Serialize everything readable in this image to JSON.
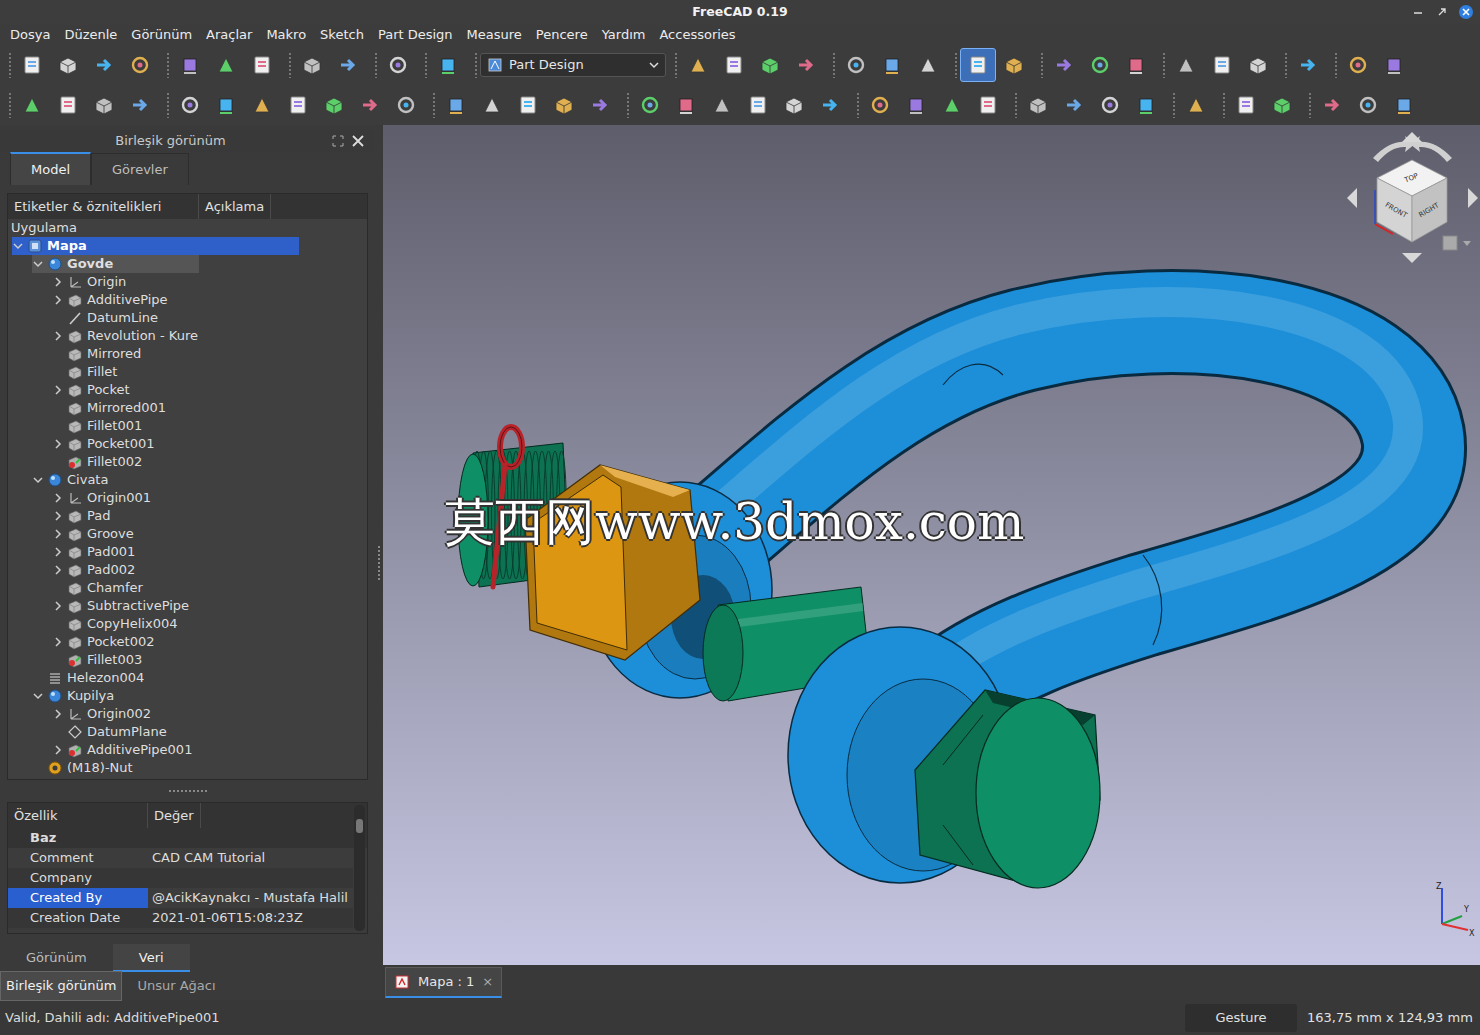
{
  "window": {
    "title": "FreeCAD 0.19"
  },
  "menu": [
    "Dosya",
    "Düzenle",
    "Görünüm",
    "Araçlar",
    "Makro",
    "Sketch",
    "Part Design",
    "Measure",
    "Pencere",
    "Yardım",
    "Accessories"
  ],
  "toolbar": {
    "rows": [
      [
        {
          "kind": "buttons",
          "buttons": [
            {
              "selected": false
            },
            {
              "selected": false
            },
            {
              "selected": false
            },
            {
              "selected": false
            }
          ]
        },
        {
          "kind": "buttons",
          "buttons": [
            {
              "selected": false
            },
            {
              "selected": false
            },
            {
              "selected": false
            }
          ]
        },
        {
          "kind": "buttons",
          "buttons": [
            {
              "selected": false
            },
            {
              "selected": false
            }
          ]
        },
        {
          "kind": "buttons",
          "buttons": [
            {
              "selected": false
            }
          ]
        },
        {
          "kind": "buttons",
          "buttons": [
            {
              "selected": false
            }
          ]
        },
        {
          "kind": "workbench",
          "label": "Part Design"
        },
        {
          "kind": "buttons",
          "buttons": [
            {
              "selected": false
            },
            {
              "selected": false
            },
            {
              "selected": false
            },
            {
              "selected": false
            }
          ]
        },
        {
          "kind": "buttons",
          "buttons": [
            {
              "selected": false
            },
            {
              "selected": false
            },
            {
              "selected": false
            }
          ]
        },
        {
          "kind": "buttons",
          "buttons": [
            {
              "selected": true
            },
            {
              "selected": false
            }
          ]
        },
        {
          "kind": "buttons",
          "buttons": [
            {
              "selected": false
            },
            {
              "selected": false
            },
            {
              "selected": false
            }
          ]
        },
        {
          "kind": "buttons",
          "buttons": [
            {
              "selected": false
            },
            {
              "selected": false
            },
            {
              "selected": false
            }
          ]
        },
        {
          "kind": "buttons",
          "buttons": [
            {
              "selected": false
            }
          ]
        },
        {
          "kind": "buttons",
          "buttons": [
            {
              "selected": false
            },
            {
              "selected": false
            }
          ]
        }
      ],
      [
        {
          "kind": "buttons",
          "buttons": [
            {
              "selected": false
            },
            {
              "selected": false
            },
            {
              "selected": false
            },
            {
              "selected": false
            }
          ]
        },
        {
          "kind": "buttons",
          "buttons": [
            {
              "selected": false
            },
            {
              "selected": false
            },
            {
              "selected": false
            },
            {
              "selected": false
            },
            {
              "selected": false
            },
            {
              "selected": false
            },
            {
              "selected": false
            }
          ]
        },
        {
          "kind": "buttons",
          "buttons": [
            {
              "selected": false
            },
            {
              "selected": false
            },
            {
              "selected": false
            },
            {
              "selected": false
            },
            {
              "selected": false
            }
          ]
        },
        {
          "kind": "buttons",
          "buttons": [
            {
              "selected": false
            },
            {
              "selected": false
            },
            {
              "selected": false
            },
            {
              "selected": false
            },
            {
              "selected": false
            },
            {
              "selected": false
            }
          ]
        },
        {
          "kind": "buttons",
          "buttons": [
            {
              "selected": false
            },
            {
              "selected": false
            },
            {
              "selected": false
            },
            {
              "selected": false
            }
          ]
        },
        {
          "kind": "buttons",
          "buttons": [
            {
              "selected": false
            },
            {
              "selected": false
            },
            {
              "selected": false
            },
            {
              "selected": false
            }
          ]
        },
        {
          "kind": "buttons",
          "buttons": [
            {
              "selected": false
            }
          ]
        },
        {
          "kind": "buttons",
          "buttons": [
            {
              "selected": false
            },
            {
              "selected": false
            }
          ]
        },
        {
          "kind": "buttons",
          "buttons": [
            {
              "selected": false
            },
            {
              "selected": false
            },
            {
              "selected": false
            }
          ]
        }
      ]
    ]
  },
  "panel": {
    "title": "Birleşik görünüm",
    "tabs": [
      {
        "label": "Model",
        "selected": true
      },
      {
        "label": "Görevler",
        "selected": false
      }
    ]
  },
  "tree": {
    "columns": [
      "Etiketler & öznitelikleri",
      "Açıklama"
    ],
    "items": [
      {
        "label": "Uygulama",
        "depth": 0,
        "kind": "root",
        "expandable": false,
        "expanded": false,
        "selected": false,
        "active": false
      },
      {
        "label": "Mapa",
        "depth": 0,
        "kind": "document",
        "expandable": true,
        "expanded": true,
        "selected": true,
        "active": true
      },
      {
        "label": "Govde",
        "depth": 1,
        "kind": "body",
        "expandable": true,
        "expanded": true,
        "selected": false,
        "active": true
      },
      {
        "label": "Origin",
        "depth": 2,
        "kind": "origin",
        "expandable": true,
        "expanded": false,
        "selected": false,
        "active": false
      },
      {
        "label": "AdditivePipe",
        "depth": 2,
        "kind": "feature",
        "expandable": true,
        "expanded": false,
        "selected": false,
        "active": false
      },
      {
        "label": "DatumLine",
        "depth": 2,
        "kind": "datum-line",
        "expandable": false,
        "expanded": false,
        "selected": false,
        "active": false
      },
      {
        "label": "Revolution - Kure",
        "depth": 2,
        "kind": "feature",
        "expandable": true,
        "expanded": false,
        "selected": false,
        "active": false
      },
      {
        "label": "Mirrored",
        "depth": 2,
        "kind": "feature",
        "expandable": false,
        "expanded": false,
        "selected": false,
        "active": false
      },
      {
        "label": "Fillet",
        "depth": 2,
        "kind": "feature",
        "expandable": false,
        "expanded": false,
        "selected": false,
        "active": false
      },
      {
        "label": "Pocket",
        "depth": 2,
        "kind": "feature",
        "expandable": true,
        "expanded": false,
        "selected": false,
        "active": false
      },
      {
        "label": "Mirrored001",
        "depth": 2,
        "kind": "feature",
        "expandable": false,
        "expanded": false,
        "selected": false,
        "active": false
      },
      {
        "label": "Fillet001",
        "depth": 2,
        "kind": "feature",
        "expandable": false,
        "expanded": false,
        "selected": false,
        "active": false
      },
      {
        "label": "Pocket001",
        "depth": 2,
        "kind": "feature",
        "expandable": true,
        "expanded": false,
        "selected": false,
        "active": false
      },
      {
        "label": "Fillet002",
        "depth": 2,
        "kind": "tip",
        "expandable": false,
        "expanded": false,
        "selected": false,
        "active": false
      },
      {
        "label": "Civata",
        "depth": 1,
        "kind": "body",
        "expandable": true,
        "expanded": true,
        "selected": false,
        "active": false
      },
      {
        "label": "Origin001",
        "depth": 2,
        "kind": "origin",
        "expandable": true,
        "expanded": false,
        "selected": false,
        "active": false
      },
      {
        "label": "Pad",
        "depth": 2,
        "kind": "feature",
        "expandable": true,
        "expanded": false,
        "selected": false,
        "active": false
      },
      {
        "label": "Groove",
        "depth": 2,
        "kind": "feature",
        "expandable": true,
        "expanded": false,
        "selected": false,
        "active": false
      },
      {
        "label": "Pad001",
        "depth": 2,
        "kind": "feature",
        "expandable": true,
        "expanded": false,
        "selected": false,
        "active": false
      },
      {
        "label": "Pad002",
        "depth": 2,
        "kind": "feature",
        "expandable": true,
        "expanded": false,
        "selected": false,
        "active": false
      },
      {
        "label": "Chamfer",
        "depth": 2,
        "kind": "feature",
        "expandable": false,
        "expanded": false,
        "selected": false,
        "active": false
      },
      {
        "label": "SubtractivePipe",
        "depth": 2,
        "kind": "feature",
        "expandable": true,
        "expanded": false,
        "selected": false,
        "active": false
      },
      {
        "label": "CopyHelix004",
        "depth": 2,
        "kind": "feature",
        "expandable": false,
        "expanded": false,
        "selected": false,
        "active": false
      },
      {
        "label": "Pocket002",
        "depth": 2,
        "kind": "feature",
        "expandable": true,
        "expanded": false,
        "selected": false,
        "active": false
      },
      {
        "label": "Fillet003",
        "depth": 2,
        "kind": "tip",
        "expandable": false,
        "expanded": false,
        "selected": false,
        "active": false
      },
      {
        "label": "Helezon004",
        "depth": 1,
        "kind": "helix",
        "expandable": false,
        "expanded": false,
        "selected": false,
        "active": false
      },
      {
        "label": "Kupilya",
        "depth": 1,
        "kind": "body",
        "expandable": true,
        "expanded": true,
        "selected": false,
        "active": false
      },
      {
        "label": "Origin002",
        "depth": 2,
        "kind": "origin",
        "expandable": true,
        "expanded": false,
        "selected": false,
        "active": false
      },
      {
        "label": "DatumPlane",
        "depth": 2,
        "kind": "datum-plane",
        "expandable": false,
        "expanded": false,
        "selected": false,
        "active": false
      },
      {
        "label": "AdditivePipe001",
        "depth": 2,
        "kind": "tip",
        "expandable": true,
        "expanded": false,
        "selected": false,
        "active": false
      },
      {
        "label": "(M18)-Nut",
        "depth": 1,
        "kind": "nut",
        "expandable": false,
        "expanded": false,
        "selected": false,
        "active": false
      }
    ]
  },
  "properties": {
    "columns": [
      "Özellik",
      "Değer"
    ],
    "group": "Baz",
    "rows": [
      {
        "name": "Comment",
        "value": "CAD CAM Tutorial",
        "selected": false
      },
      {
        "name": "Company",
        "value": "",
        "selected": false
      },
      {
        "name": "Created By",
        "value": "@AcikKaynakcı - Mustafa Halil",
        "selected": true
      },
      {
        "name": "Creation Date",
        "value": "2021-01-06T15:08:23Z",
        "selected": false
      }
    ]
  },
  "property_tabs": [
    {
      "label": "Görünüm",
      "selected": false
    },
    {
      "label": "Veri",
      "selected": true
    }
  ],
  "dock_tabs": [
    {
      "label": "Birleşik görünüm",
      "selected": true
    },
    {
      "label": "Unsur Ağacı",
      "selected": false
    }
  ],
  "view": {
    "watermark": "莫西网www.3dmox.com",
    "navcube": [
      "TOP",
      "FRONT",
      "RIGHT"
    ],
    "axes": [
      {
        "label": "Z",
        "color": "#2f4fe0"
      },
      {
        "label": "Y",
        "color": "#22a040"
      },
      {
        "label": "X",
        "color": "#e03030"
      }
    ]
  },
  "model": {
    "parts": [
      {
        "kind": "bow",
        "color": "#1d8fd8"
      },
      {
        "kind": "bolt",
        "color": "#0f8f66"
      },
      {
        "kind": "nut",
        "color": "#dc9612"
      },
      {
        "kind": "cotter",
        "color": "#b8232a"
      }
    ]
  },
  "doc_tabs": [
    {
      "label": "Mapa : 1",
      "close": "×",
      "selected": true
    }
  ],
  "status_bar": {
    "message": "Valid, Dahili adı: AdditivePipe001",
    "nav_style": "Gesture",
    "dimensions": "163,75 mm x 124,93 mm"
  }
}
